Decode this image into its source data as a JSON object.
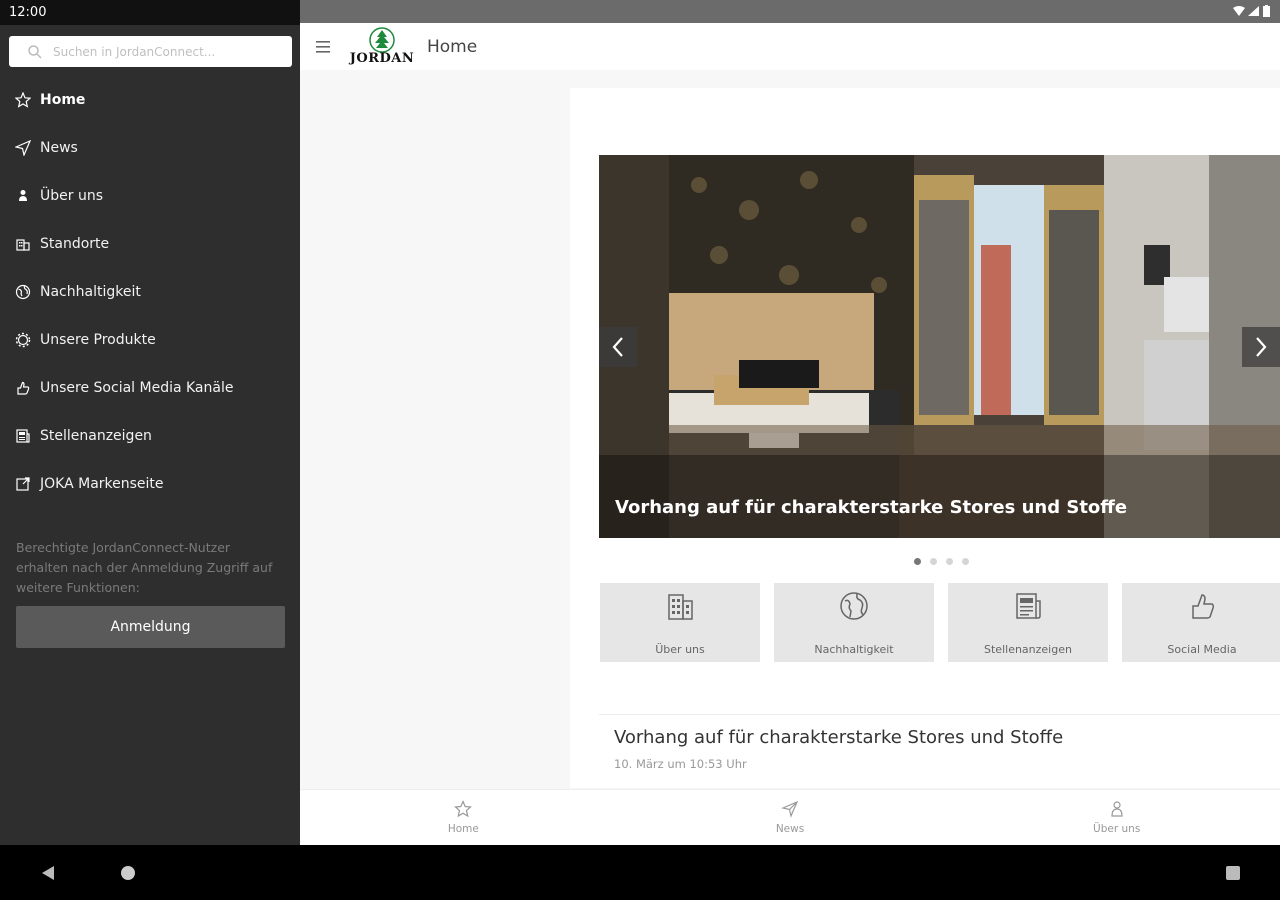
{
  "status": {
    "time": "12:00"
  },
  "drawer": {
    "search_placeholder": "Suchen in JordanConnect...",
    "items": [
      {
        "label": "Home",
        "icon": "star-icon"
      },
      {
        "label": "News",
        "icon": "send-icon"
      },
      {
        "label": "Über uns",
        "icon": "person-icon"
      },
      {
        "label": "Standorte",
        "icon": "building-icon"
      },
      {
        "label": "Nachhaltigkeit",
        "icon": "globe-icon"
      },
      {
        "label": "Unsere Produkte",
        "icon": "gear-icon"
      },
      {
        "label": "Unsere Social Media Kanäle",
        "icon": "thumb-icon"
      },
      {
        "label": "Stellenanzeigen",
        "icon": "newspaper-icon"
      },
      {
        "label": "JOKA Markenseite",
        "icon": "external-link-icon"
      }
    ],
    "note": "Berechtigte JordanConnect-Nutzer erhalten nach der Anmeldung Zugriff auf weitere Funktionen:",
    "login_label": "Anmeldung"
  },
  "header": {
    "logo_text": "JORDAN",
    "title": "Home"
  },
  "slider": {
    "caption": "Vorhang auf für charakterstarke Stores und Stoffe",
    "slide_count": 4,
    "active_slide": 1
  },
  "tiles": [
    {
      "label": "Über uns",
      "icon": "building-icon"
    },
    {
      "label": "Nachhaltigkeit",
      "icon": "globe-icon"
    },
    {
      "label": "Stellenanzeigen",
      "icon": "newspaper-icon"
    },
    {
      "label": "Social Media",
      "icon": "thumb-icon"
    }
  ],
  "news": {
    "title": "Vorhang auf für charakterstarke Stores und Stoffe",
    "date": "10. März um 10:53 Uhr"
  },
  "bottom_nav": [
    {
      "label": "Home",
      "icon": "star-icon"
    },
    {
      "label": "News",
      "icon": "send-icon"
    },
    {
      "label": "Über uns",
      "icon": "person-icon"
    }
  ],
  "colors": {
    "drawer_bg": "#2e2e2e",
    "logo_green": "#1e8a3c"
  }
}
